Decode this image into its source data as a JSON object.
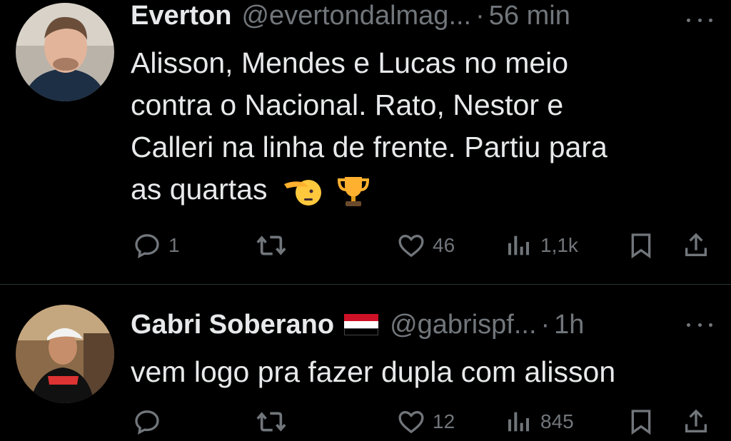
{
  "tweets": [
    {
      "name": "Everton",
      "handle": "@evertondalmag...",
      "time": "56 min",
      "text_lines": [
        "Alisson, Mendes e Lucas no meio",
        "contra o Nacional. Rato, Nestor e",
        "Calleri na linha de frente. Partiu para",
        "as quartas"
      ],
      "emojis": [
        "saluting-face-icon",
        "trophy-icon"
      ],
      "replies": "1",
      "retweets": "",
      "likes": "46",
      "views": "1,1k"
    },
    {
      "name": "Gabri Soberano",
      "flag": "flag-icon",
      "handle": "@gabrispf...",
      "time": "1h",
      "text_lines": [
        "vem logo pra fazer dupla com alisson"
      ],
      "replies": "",
      "retweets": "",
      "likes": "12",
      "views": "845"
    }
  ],
  "separator": "·",
  "colors": {
    "background": "#000000",
    "text": "#e7e9ea",
    "secondary": "#71767b",
    "divider": "#2f3336"
  }
}
